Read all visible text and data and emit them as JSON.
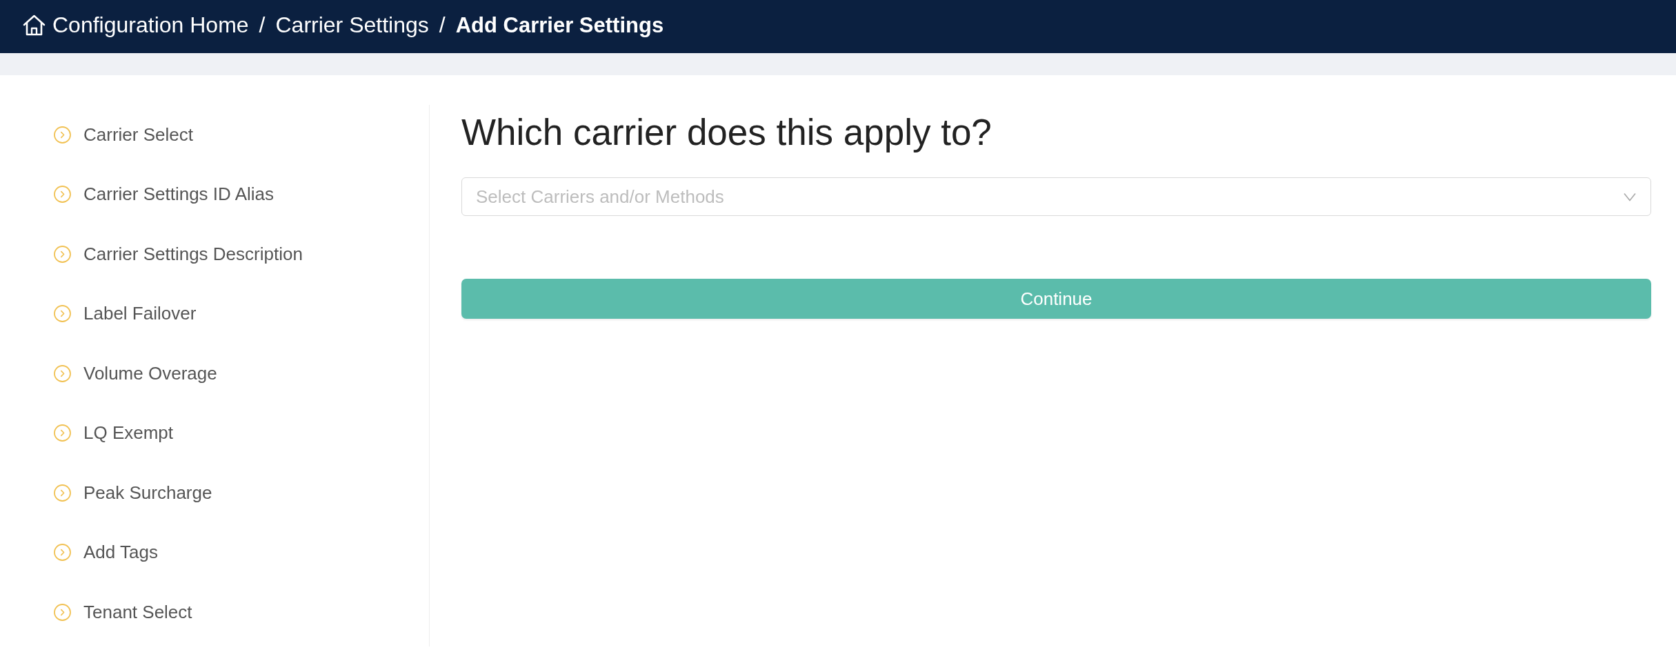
{
  "header": {
    "breadcrumbs": [
      {
        "kind": "home",
        "label": "Configuration Home",
        "current": false
      },
      {
        "kind": "link",
        "separator": "/",
        "label": "Carrier Settings",
        "current": false
      },
      {
        "kind": "link",
        "separator": "/",
        "label": "Add Carrier Settings",
        "current": true
      }
    ]
  },
  "sidebar": {
    "steps": [
      {
        "label": "Carrier Select"
      },
      {
        "label": "Carrier Settings ID Alias"
      },
      {
        "label": "Carrier Settings Description"
      },
      {
        "label": "Label Failover"
      },
      {
        "label": "Volume Overage"
      },
      {
        "label": "LQ Exempt"
      },
      {
        "label": "Peak Surcharge"
      },
      {
        "label": "Add Tags"
      },
      {
        "label": "Tenant Select"
      }
    ]
  },
  "main": {
    "question": "Which carrier does this apply to?",
    "select": {
      "placeholder": "Select Carriers and/or Methods"
    },
    "continue_button": {
      "label": "Continue"
    }
  }
}
